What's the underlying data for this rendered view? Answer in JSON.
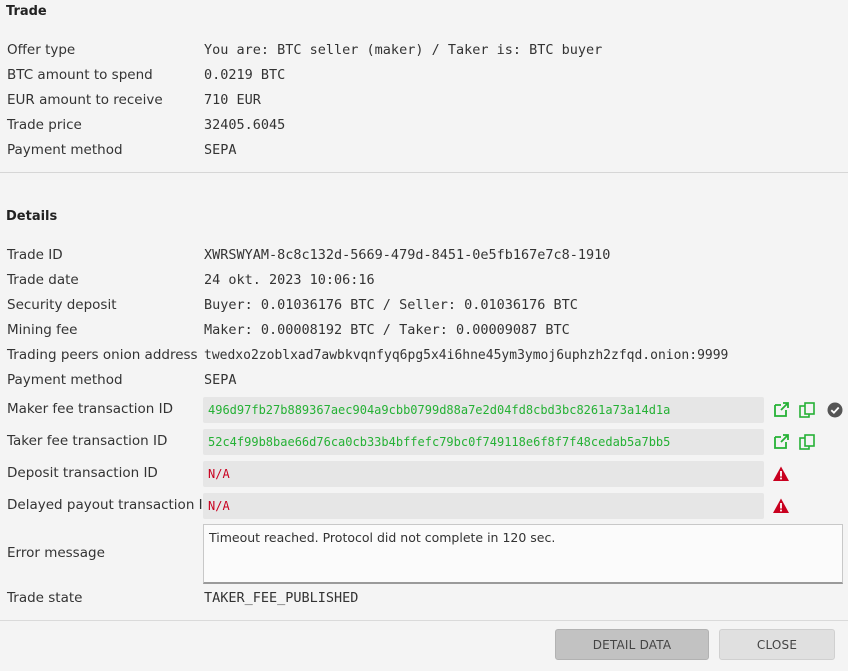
{
  "trade": {
    "title": "Trade",
    "rows": [
      {
        "label": "Offer type",
        "value": "You are: BTC seller (maker) / Taker is: BTC buyer"
      },
      {
        "label": "BTC amount to spend",
        "value": "0.0219 BTC"
      },
      {
        "label": "EUR amount to receive",
        "value": "710 EUR"
      },
      {
        "label": "Trade price",
        "value": "32405.6045"
      },
      {
        "label": "Payment method",
        "value": "SEPA"
      }
    ]
  },
  "details": {
    "title": "Details",
    "rows": [
      {
        "label": "Trade ID",
        "value": "XWRSWYAM-8c8c132d-5669-479d-8451-0e5fb167e7c8-1910"
      },
      {
        "label": "Trade date",
        "value": "24 okt. 2023 10:06:16"
      },
      {
        "label": "Security deposit",
        "value": "Buyer: 0.01036176 BTC / Seller: 0.01036176 BTC"
      },
      {
        "label": "Mining fee",
        "value": "Maker: 0.00008192 BTC / Taker: 0.00009087 BTC"
      },
      {
        "label": "Trading peers onion address",
        "value": "twedxo2zoblxad7awbkvqnfyq6pg5x4i6hne45ym3ymoj6uphzh2zfqd.onion:9999"
      },
      {
        "label": "Payment method",
        "value": "SEPA"
      }
    ],
    "maker_fee_tx": {
      "label": "Maker fee transaction ID",
      "value": "496d97fb27b889367aec904a9cbb0799d88a7e2d04fd8cbd3bc8261a73a14d1a"
    },
    "taker_fee_tx": {
      "label": "Taker fee transaction ID",
      "value": "52c4f99b8bae66d76ca0cb33b4bffefc79bc0f749118e6f8f7f48cedab5a7bb5"
    },
    "deposit_tx": {
      "label": "Deposit transaction ID",
      "value": "N/A"
    },
    "delayed_payout_tx": {
      "label": "Delayed payout transaction ID",
      "value": "N/A"
    },
    "error": {
      "label": "Error message",
      "value": "Timeout reached. Protocol did not complete in 120 sec."
    },
    "trade_state": {
      "label": "Trade state",
      "value": "TAKER_FEE_PUBLISHED"
    }
  },
  "buttons": {
    "detail_data": "DETAIL DATA",
    "close": "CLOSE"
  },
  "colors": {
    "tx_green": "#25b135",
    "error_red": "#c9001f",
    "background": "#f4f4f4"
  },
  "icons": [
    "open-external-icon",
    "copy-icon",
    "confirmed-check-icon",
    "warning-icon"
  ]
}
